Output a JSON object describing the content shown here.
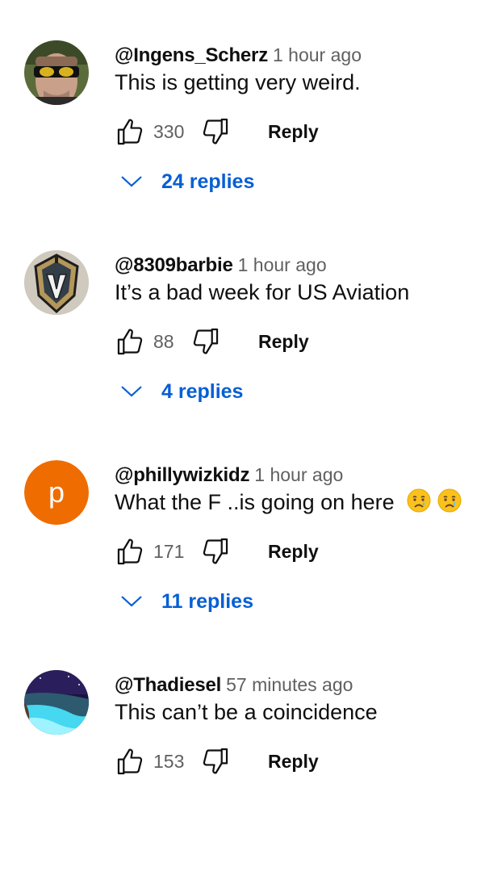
{
  "comments": [
    {
      "author": "@Ingens_Scherz",
      "time": "1 hour ago",
      "text": "This is getting very weird.",
      "likes": "330",
      "reply_label": "Reply",
      "replies_label": "24 replies",
      "avatar": "man-with-sunglasses-photo"
    },
    {
      "author": "@8309barbie",
      "time": "1 hour ago",
      "text": "It’s a bad week for US Aviation",
      "likes": "88",
      "reply_label": "Reply",
      "replies_label": "4 replies",
      "avatar": "knight-helmet-logo"
    },
    {
      "author": "@phillywizkidz",
      "time": "1 hour ago",
      "text": "What the F ..is going on here",
      "emojis": [
        "😢",
        "😢"
      ],
      "likes": "171",
      "reply_label": "Reply",
      "replies_label": "11 replies",
      "avatar_letter": "p",
      "avatar_color": "#ef6c00"
    },
    {
      "author": "@Thadiesel",
      "time": "57 minutes ago",
      "text": "This can’t be a coincidence",
      "likes": "153",
      "reply_label": "Reply",
      "avatar": "beach-night-photo"
    }
  ],
  "colors": {
    "link_blue": "#065fd4",
    "secondary_text": "#606060",
    "primary_text": "#0f0f0f"
  }
}
